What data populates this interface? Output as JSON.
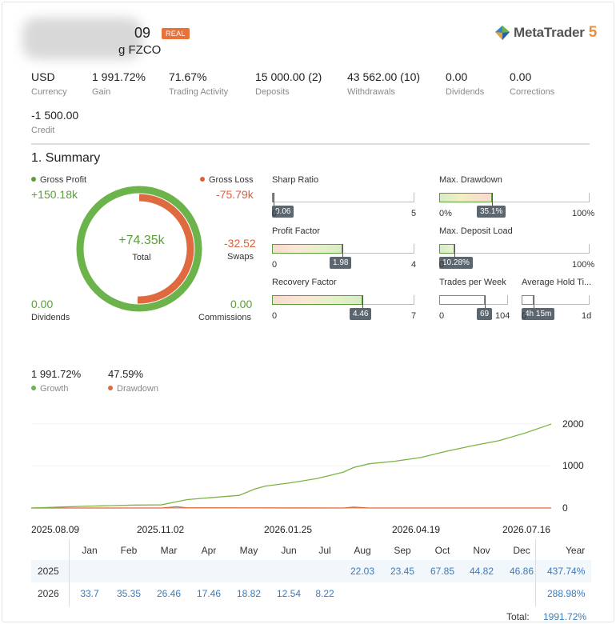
{
  "header": {
    "account_number_tail": "09",
    "badge": "REAL",
    "company_tail": "g FZCO",
    "brand": "MetaTrader",
    "brand_version": "5"
  },
  "stats": [
    {
      "value": "USD",
      "label": "Currency"
    },
    {
      "value": "1 991.72%",
      "label": "Gain"
    },
    {
      "value": "71.67%",
      "label": "Trading Activity"
    },
    {
      "value": "15 000.00 (2)",
      "label": "Deposits"
    },
    {
      "value": "43 562.00 (10)",
      "label": "Withdrawals"
    },
    {
      "value": "0.00",
      "label": "Dividends"
    },
    {
      "value": "0.00",
      "label": "Corrections"
    },
    {
      "value": "-1 500.00",
      "label": "Credit"
    }
  ],
  "summary": {
    "title": "1. Summary",
    "gross_profit_label": "Gross Profit",
    "gross_profit": "+150.18k",
    "gross_loss_label": "Gross Loss",
    "gross_loss": "-75.79k",
    "total": "+74.35k",
    "total_label": "Total",
    "swaps": "-32.52",
    "swaps_label": "Swaps",
    "dividends": "0.00",
    "dividends_label": "Dividends",
    "commissions": "0.00",
    "commissions_label": "Commissions",
    "loss_share": 0.505
  },
  "metrics": {
    "sharp": {
      "name": "Sharp Ratio",
      "value": "0.06",
      "min": "0",
      "max": "5",
      "fraction": 0.012
    },
    "max_dd": {
      "name": "Max. Drawdown",
      "value": "35.1%",
      "min": "0%",
      "max": "100%",
      "fraction": 0.351
    },
    "profit_factor": {
      "name": "Profit Factor",
      "value": "1.98",
      "min": "0",
      "max": "4",
      "fraction": 0.495
    },
    "deposit_load": {
      "name": "Max. Deposit Load",
      "value": "10.28%",
      "min": "0",
      "max": "100%",
      "fraction": 0.1028
    },
    "recovery": {
      "name": "Recovery Factor",
      "value": "4.46",
      "min": "0",
      "max": "7",
      "fraction": 0.637
    },
    "trades_week": {
      "name": "Trades per Week",
      "value": "69",
      "min": "0",
      "max": "104",
      "fraction": 0.663
    },
    "hold_time": {
      "name": "Average Hold Ti...",
      "value": "4h 15m",
      "min": "0",
      "max": "1d",
      "fraction": 0.177
    }
  },
  "growth": {
    "growth_value": "1 991.72%",
    "growth_label": "Growth",
    "drawdown_value": "47.59%",
    "drawdown_label": "Drawdown"
  },
  "chart_data": {
    "type": "line",
    "x_tick_labels": [
      "2025.08.09",
      "2025.11.02",
      "2026.01.25",
      "2026.04.19",
      "2026.07.16"
    ],
    "y_ticks": [
      0,
      1000,
      2000
    ],
    "ylim": [
      0,
      2050
    ],
    "series": [
      {
        "name": "Growth",
        "color": "#7cb342",
        "x": [
          0,
          0.05,
          0.1,
          0.15,
          0.2,
          0.25,
          0.28,
          0.3,
          0.35,
          0.4,
          0.43,
          0.45,
          0.5,
          0.55,
          0.6,
          0.62,
          0.65,
          0.7,
          0.75,
          0.8,
          0.85,
          0.9,
          0.95,
          1.0
        ],
        "y": [
          0,
          20,
          40,
          55,
          70,
          75,
          150,
          200,
          250,
          300,
          450,
          520,
          600,
          700,
          850,
          960,
          1050,
          1110,
          1200,
          1350,
          1480,
          1600,
          1780,
          1991.72
        ]
      },
      {
        "name": "Drawdown",
        "color": "#e06a3f",
        "x": [
          0,
          0.25,
          0.28,
          0.3,
          0.6,
          0.62,
          0.65,
          1.0
        ],
        "y": [
          0,
          0,
          30,
          5,
          0,
          20,
          0,
          0
        ]
      }
    ]
  },
  "monthly": {
    "months": [
      "Jan",
      "Feb",
      "Mar",
      "Apr",
      "May",
      "Jun",
      "Jul",
      "Aug",
      "Sep",
      "Oct",
      "Nov",
      "Dec"
    ],
    "year_header": "Year",
    "rows": [
      {
        "year": "2025",
        "values": [
          "",
          "",
          "",
          "",
          "",
          "",
          "",
          "22.03",
          "23.45",
          "67.85",
          "44.82",
          "46.86"
        ],
        "total": "437.74%"
      },
      {
        "year": "2026",
        "values": [
          "33.7",
          "35.35",
          "26.46",
          "17.46",
          "18.82",
          "12.54",
          "8.22",
          "",
          "",
          "",
          "",
          ""
        ],
        "total": "288.98%"
      }
    ],
    "total_label": "Total:",
    "total_value": "1991.72%"
  }
}
